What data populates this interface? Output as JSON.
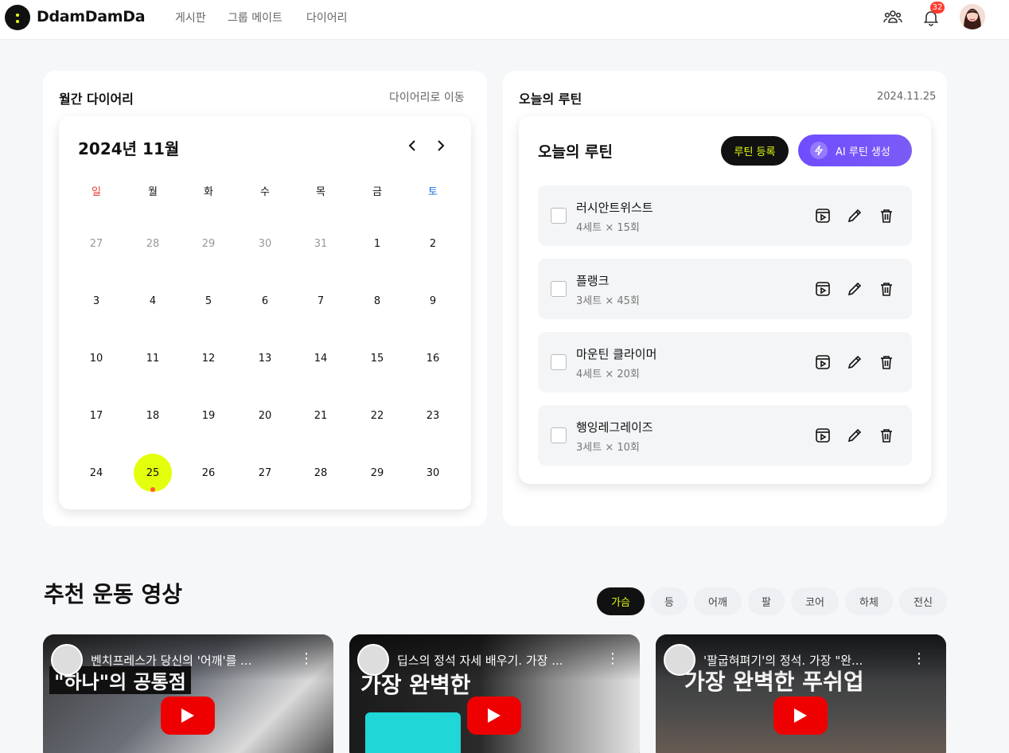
{
  "header": {
    "brand": "DdamDamDa",
    "nav": [
      "게시판",
      "그룹 메이트",
      "다이어리"
    ],
    "notification_count": "32",
    "icons": [
      "group-icon",
      "bell-icon",
      "avatar"
    ]
  },
  "diary": {
    "title": "월간 다이어리",
    "link": "다이어리로 이동",
    "calendar": {
      "title": "2024년 11월",
      "weekdays": [
        "일",
        "월",
        "화",
        "수",
        "목",
        "금",
        "토"
      ],
      "weeks": [
        [
          "27",
          "28",
          "29",
          "30",
          "31",
          "1",
          "2"
        ],
        [
          "3",
          "4",
          "5",
          "6",
          "7",
          "8",
          "9"
        ],
        [
          "10",
          "11",
          "12",
          "13",
          "14",
          "15",
          "16"
        ],
        [
          "17",
          "18",
          "19",
          "20",
          "21",
          "22",
          "23"
        ],
        [
          "24",
          "25",
          "26",
          "27",
          "28",
          "29",
          "30"
        ]
      ],
      "today": "25"
    }
  },
  "today_routine": {
    "title": "오늘의 루틴",
    "date": "2024.11.25",
    "panel_title": "오늘의 루틴",
    "register_label": "루틴 등록",
    "ai_label": "AI 루틴 생성",
    "items": [
      {
        "name": "러시안트위스트",
        "meta": "4세트 × 15회"
      },
      {
        "name": "플랭크",
        "meta": "3세트 × 45회"
      },
      {
        "name": "마운틴 클라이머",
        "meta": "4세트 × 20회"
      },
      {
        "name": "행잉레그레이즈",
        "meta": "3세트 × 10회"
      }
    ]
  },
  "videos": {
    "title": "추천 운동 영상",
    "chips": [
      "가슴",
      "등",
      "어깨",
      "팔",
      "코어",
      "하체",
      "전신"
    ],
    "active_chip": "가슴",
    "items": [
      {
        "title": "벤치프레스가 당신의 '어깨'를 ...",
        "big_text": "\"하나\"의 공통점",
        "accent": "#ffd21a"
      },
      {
        "title": "딥스의 정석 자세 배우기. 가장 ...",
        "big_text": "가장 완벽한",
        "accent": "#20d6d6"
      },
      {
        "title": "'팔굽혀펴기'의 정석. 가장 \"완...",
        "big_text": "가장 완벽한 푸쉬업",
        "accent": "#20d6b0"
      }
    ]
  },
  "colors": {
    "accent": "#e4ff0e",
    "ai": "#6f4cff",
    "sunday": "#e53935",
    "saturday": "#1e6fd9"
  }
}
